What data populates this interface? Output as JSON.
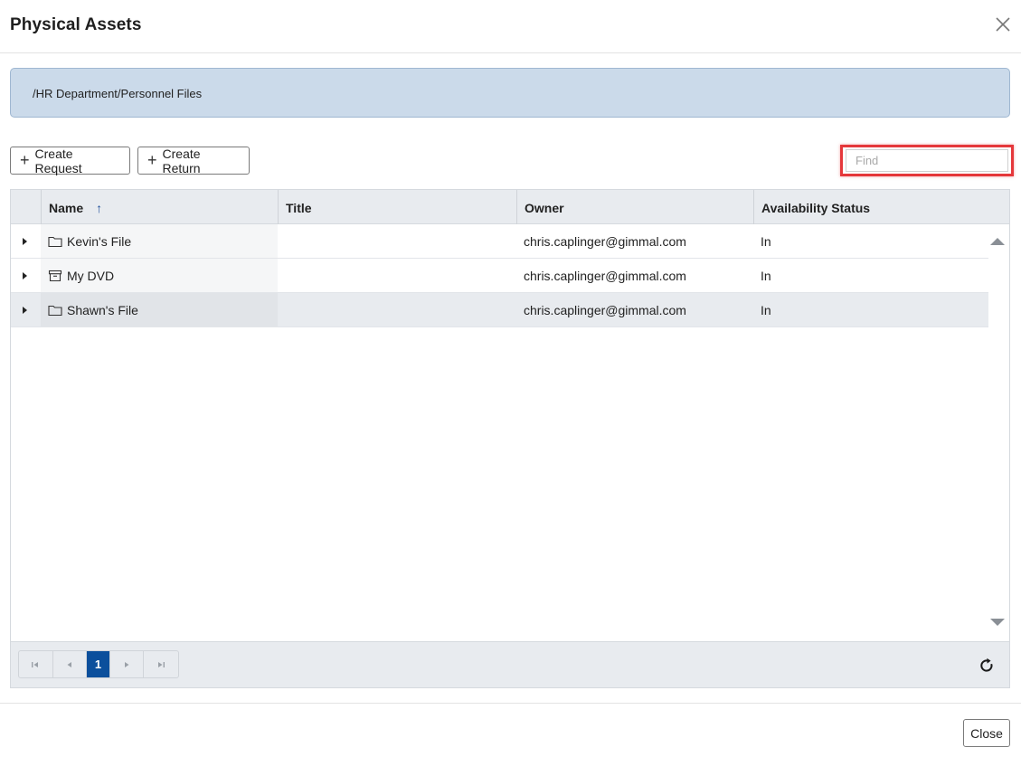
{
  "dialog": {
    "title": "Physical Assets"
  },
  "path": "/HR Department/Personnel Files",
  "toolbar": {
    "create_request_label": "Create Request",
    "create_return_label": "Create Return",
    "find_placeholder": "Find",
    "find_value": ""
  },
  "grid": {
    "columns": [
      "Name",
      "Title",
      "Owner",
      "Availability Status"
    ],
    "sort": {
      "column": "Name",
      "direction": "ascending"
    },
    "rows": [
      {
        "icon": "folder-icon",
        "name": "Kevin's File",
        "title": "",
        "owner": "chris.caplinger@gimmal.com",
        "status": "In"
      },
      {
        "icon": "box-icon",
        "name": "My DVD",
        "title": "",
        "owner": "chris.caplinger@gimmal.com",
        "status": "In"
      },
      {
        "icon": "folder-icon",
        "name": "Shawn's File",
        "title": "",
        "owner": "chris.caplinger@gimmal.com",
        "status": "In"
      }
    ]
  },
  "pager": {
    "current_page": "1"
  },
  "footer": {
    "close_label": "Close"
  },
  "colors": {
    "accent": "#0b4f9c",
    "path_bg": "#cbdaea",
    "highlight": "#e5383b"
  }
}
